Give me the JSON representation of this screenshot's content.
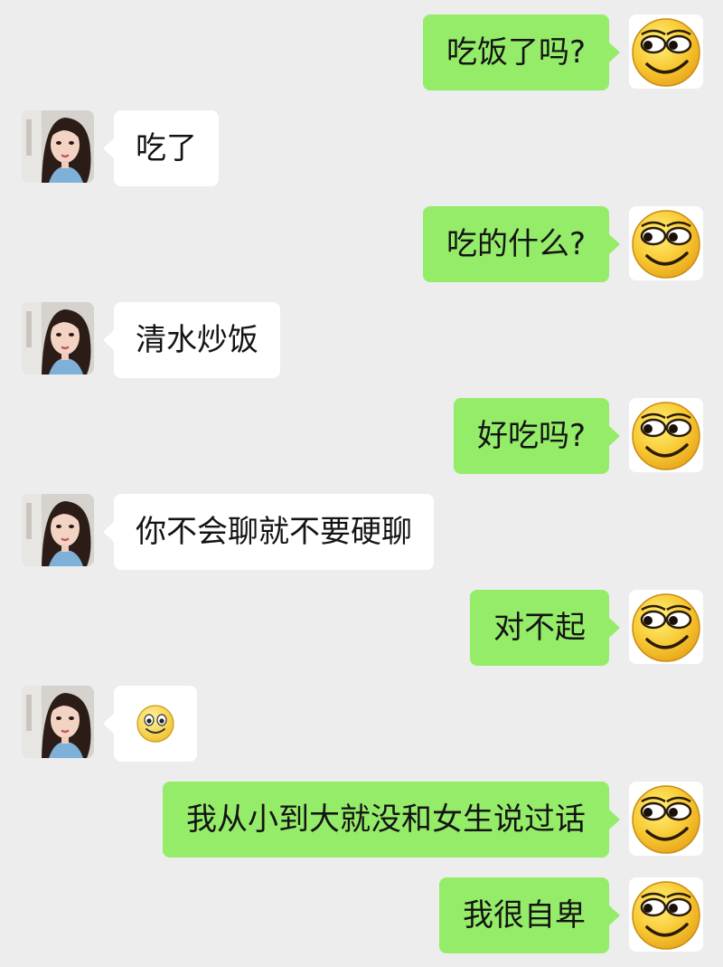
{
  "chat": {
    "messages": [
      {
        "from": "me",
        "text": "吃饭了吗?"
      },
      {
        "from": "her",
        "text": "吃了"
      },
      {
        "from": "me",
        "text": "吃的什么?"
      },
      {
        "from": "her",
        "text": "清水炒饭"
      },
      {
        "from": "me",
        "text": "好吃吗?"
      },
      {
        "from": "her",
        "text": "你不会聊就不要硬聊"
      },
      {
        "from": "me",
        "text": "对不起"
      },
      {
        "from": "her",
        "emoji": "smile-emoji"
      },
      {
        "from": "me",
        "text": "我从小到大就没和女生说过话"
      },
      {
        "from": "me",
        "text": "我很自卑"
      }
    ]
  },
  "colors": {
    "background": "#ededed",
    "my_bubble": "#95ec69",
    "her_bubble": "#ffffff",
    "text": "#141414"
  },
  "icons": {
    "my_avatar": "smirk-emoji-avatar",
    "her_avatar": "girl-portrait-avatar"
  }
}
